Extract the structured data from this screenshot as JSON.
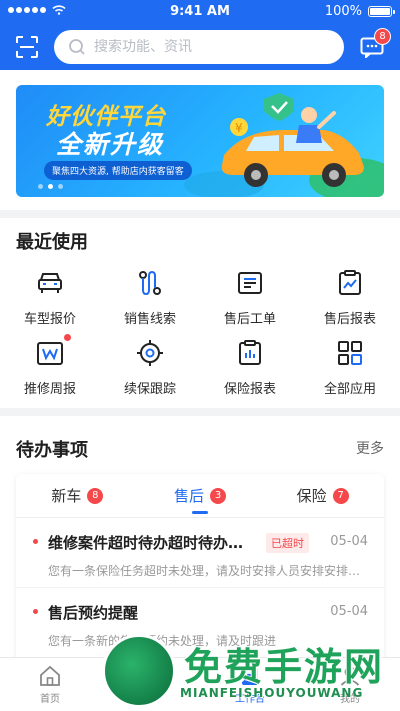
{
  "status_bar": {
    "time": "9:41 AM",
    "battery": "100%"
  },
  "header": {
    "search_placeholder": "搜索功能、资讯",
    "message_count": "8"
  },
  "banner": {
    "title_line1": "好伙伴平台",
    "title_line2": "全新升级",
    "tagline": "聚焦四大资源, 帮助店内获客留客",
    "page_count": 3,
    "active_page": 2
  },
  "recent": {
    "title": "最近使用",
    "items": [
      {
        "label": "车型报价",
        "icon": "car-icon"
      },
      {
        "label": "销售线索",
        "icon": "route-icon"
      },
      {
        "label": "售后工单",
        "icon": "work-order-icon"
      },
      {
        "label": "售后报表",
        "icon": "report-chart-icon"
      },
      {
        "label": "推修周报",
        "icon": "weekly-report-icon"
      },
      {
        "label": "续保跟踪",
        "icon": "target-icon"
      },
      {
        "label": "保险报表",
        "icon": "insurance-report-icon"
      },
      {
        "label": "全部应用",
        "icon": "all-apps-icon"
      }
    ]
  },
  "todo": {
    "title": "待办事项",
    "more": "更多",
    "tabs": [
      {
        "label": "新车",
        "count": "8"
      },
      {
        "label": "售后",
        "count": "3"
      },
      {
        "label": "保险",
        "count": "7"
      }
    ],
    "active_tab": 1,
    "items": [
      {
        "title": "维修案件超时待办超时待办超时待办",
        "badge": "已超时",
        "date": "05-04",
        "desc": "您有一条保险任务超时未处理，请及时安排人员安排安排处理"
      },
      {
        "title": "售后预约提醒",
        "badge": "",
        "date": "05-04",
        "desc": "您有一条新的售后预约未处理，请及时跟进"
      }
    ]
  },
  "tabbar": [
    {
      "label": "首页",
      "icon": "home-icon"
    },
    {
      "label": "经营",
      "icon": "business-icon"
    },
    {
      "label": "工作台",
      "icon": "workbench-icon"
    },
    {
      "label": "我的",
      "icon": "profile-icon"
    }
  ],
  "watermark": {
    "text": "免费手游网",
    "sub": "MIANFEISHOUYOUWANG"
  },
  "colors": {
    "primary": "#1f6bf2",
    "badge": "#f5484a"
  }
}
